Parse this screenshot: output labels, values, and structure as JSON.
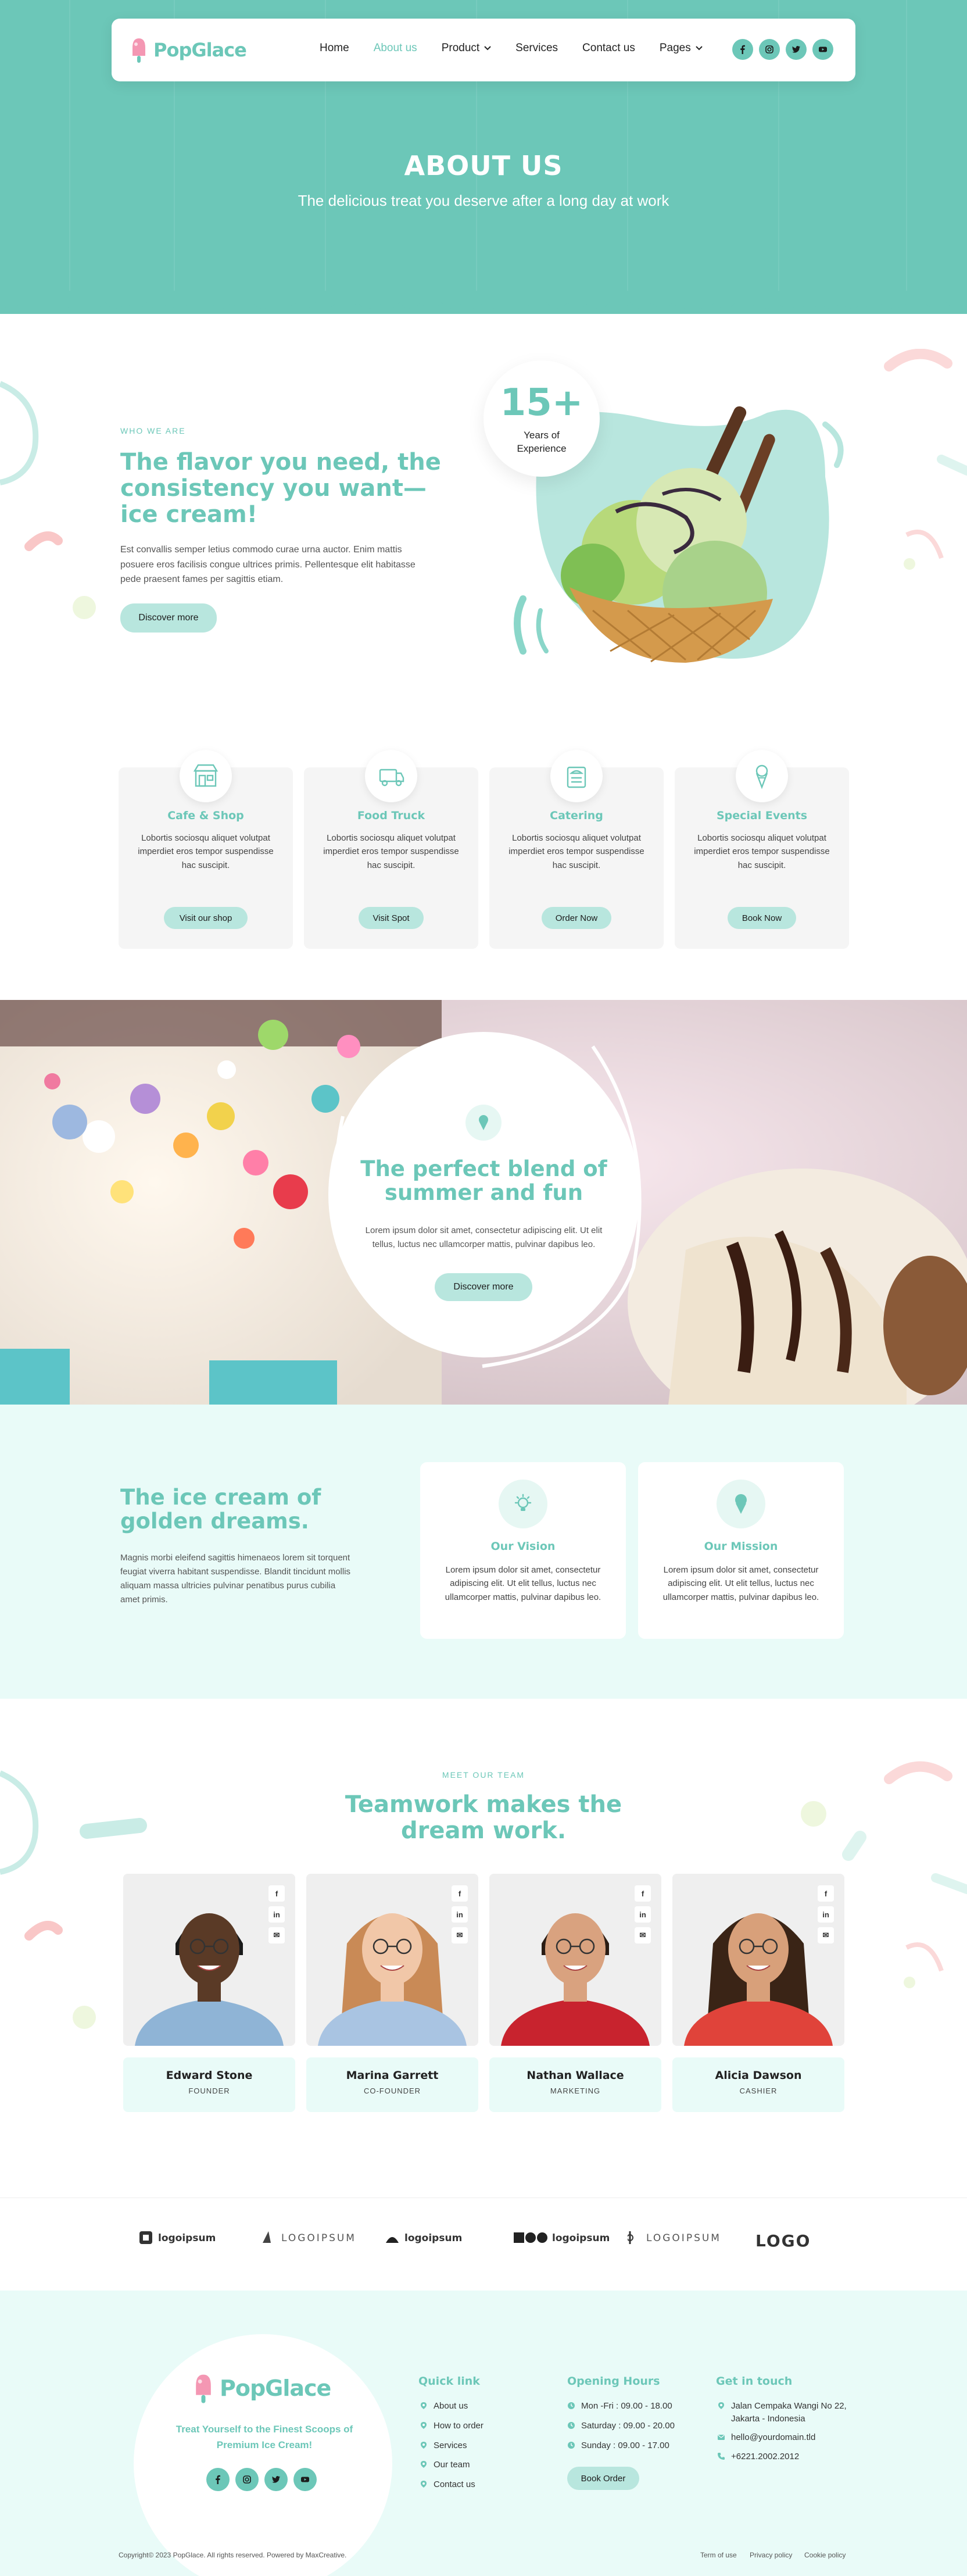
{
  "brand": {
    "name": "PopGlace",
    "accent": "#6cc7b8",
    "light_accent": "#e9fbf8",
    "button_bg": "#b8e6de"
  },
  "nav": {
    "items": [
      {
        "label": "Home",
        "active": false,
        "has_dropdown": false
      },
      {
        "label": "About us",
        "active": true,
        "has_dropdown": false
      },
      {
        "label": "Product",
        "active": false,
        "has_dropdown": true
      },
      {
        "label": "Services",
        "active": false,
        "has_dropdown": false
      },
      {
        "label": "Contact us",
        "active": false,
        "has_dropdown": false
      },
      {
        "label": "Pages",
        "active": false,
        "has_dropdown": true
      }
    ],
    "social_icons": [
      "facebook-icon",
      "instagram-icon",
      "twitter-icon",
      "youtube-icon"
    ]
  },
  "hero": {
    "title": "ABOUT US",
    "subtitle": "The delicious treat you deserve after a long day at work"
  },
  "about": {
    "eyebrow": "WHO WE ARE",
    "title": "The flavor you need, the consistency you want—ice cream!",
    "text": "Est convallis semper letius commodo curae urna auctor. Enim mattis posuere eros facilisis congue ultrices primis. Pellentesque elit habitasse pede praesent fames per sagittis etiam.",
    "button": "Discover more",
    "experience_number": "15+",
    "experience_label": "Years of Experience"
  },
  "services": [
    {
      "icon": "shop-icon",
      "title": "Cafe & Shop",
      "text": "Lobortis sociosqu aliquet volutpat imperdiet eros tempor suspendisse hac suscipit.",
      "button": "Visit our shop"
    },
    {
      "icon": "food-truck-icon",
      "title": "Food Truck",
      "text": "Lobortis sociosqu aliquet volutpat imperdiet eros tempor suspendisse hac suscipit.",
      "button": "Visit Spot"
    },
    {
      "icon": "catering-icon",
      "title": "Catering",
      "text": "Lobortis sociosqu aliquet volutpat imperdiet eros tempor suspendisse hac suscipit.",
      "button": "Order Now"
    },
    {
      "icon": "special-events-icon",
      "title": "Special Events",
      "text": "Lobortis sociosqu aliquet volutpat imperdiet eros tempor suspendisse hac suscipit.",
      "button": "Book Now"
    }
  ],
  "banner": {
    "title": "The perfect blend of summer and fun",
    "text": "Lorem ipsum dolor sit amet, consectetur adipiscing elit. Ut elit tellus, luctus nec ullamcorper mattis, pulvinar dapibus leo.",
    "button": "Discover more"
  },
  "vision": {
    "title": "The ice cream of golden dreams.",
    "text": "Magnis morbi eleifend sagittis himenaeos lorem sit torquent feugiat viverra habitant suspendisse. Blandit tincidunt mollis aliquam massa ultricies pulvinar penatibus purus cubilia amet primis.",
    "cards": [
      {
        "icon": "lightbulb-icon",
        "title": "Our Vision",
        "text": "Lorem ipsum dolor sit amet, consectetur adipiscing elit. Ut elit tellus, luctus nec ullamcorper mattis, pulvinar dapibus leo."
      },
      {
        "icon": "ice-cream-cone-icon",
        "title": "Our Mission",
        "text": "Lorem ipsum dolor sit amet, consectetur adipiscing elit. Ut elit tellus, luctus nec ullamcorper mattis, pulvinar dapibus leo."
      }
    ]
  },
  "team": {
    "eyebrow": "MEET OUR TEAM",
    "title": "Teamwork makes the dream work.",
    "members": [
      {
        "name": "Edward Stone",
        "role": "FOUNDER",
        "shirt": "#8fb4d6",
        "skin": "#5a3a26",
        "hair": "#1a1a1a"
      },
      {
        "name": "Marina Garrett",
        "role": "CO-FOUNDER",
        "shirt": "#a9c4e2",
        "skin": "#f1c7a8",
        "hair": "#c98a56"
      },
      {
        "name": "Nathan Wallace",
        "role": "MARKETING",
        "shirt": "#c8232e",
        "skin": "#d9a27f",
        "hair": "#2b1d14"
      },
      {
        "name": "Alicia Dawson",
        "role": "CASHIER",
        "shirt": "#e0433a",
        "skin": "#d8a07a",
        "hair": "#3a2416"
      }
    ],
    "member_social": [
      "f",
      "in",
      "✉"
    ]
  },
  "logos": [
    "logoipsum",
    "LOGOIPSUM",
    "logoipsum",
    "logoipsum",
    "LOGOIPSUM",
    "LOGO"
  ],
  "footer": {
    "tagline": "Treat Yourself to the Finest Scoops of Premium Ice Cream!",
    "quick_link_title": "Quick link",
    "quick_links": [
      "About us",
      "How to order",
      "Services",
      "Our team",
      "Contact us"
    ],
    "hours_title": "Opening Hours",
    "hours": [
      "Mon -Fri : 09.00 - 18.00",
      "Saturday : 09.00 - 20.00",
      "Sunday : 09.00 - 17.00"
    ],
    "book_button": "Book Order",
    "contact_title": "Get in touch",
    "contact": [
      {
        "icon": "location-icon",
        "text": "Jalan Cempaka Wangi No 22, Jakarta - Indonesia"
      },
      {
        "icon": "mail-icon",
        "text": "hello@yourdomain.tld"
      },
      {
        "icon": "phone-icon",
        "text": "+6221.2002.2012"
      }
    ],
    "copyright": "Copyright© 2023 PopGlace. All rights reserved. Powered by MaxCreative.",
    "legal": [
      "Term of use",
      "Privacy policy",
      "Cookie policy"
    ]
  }
}
